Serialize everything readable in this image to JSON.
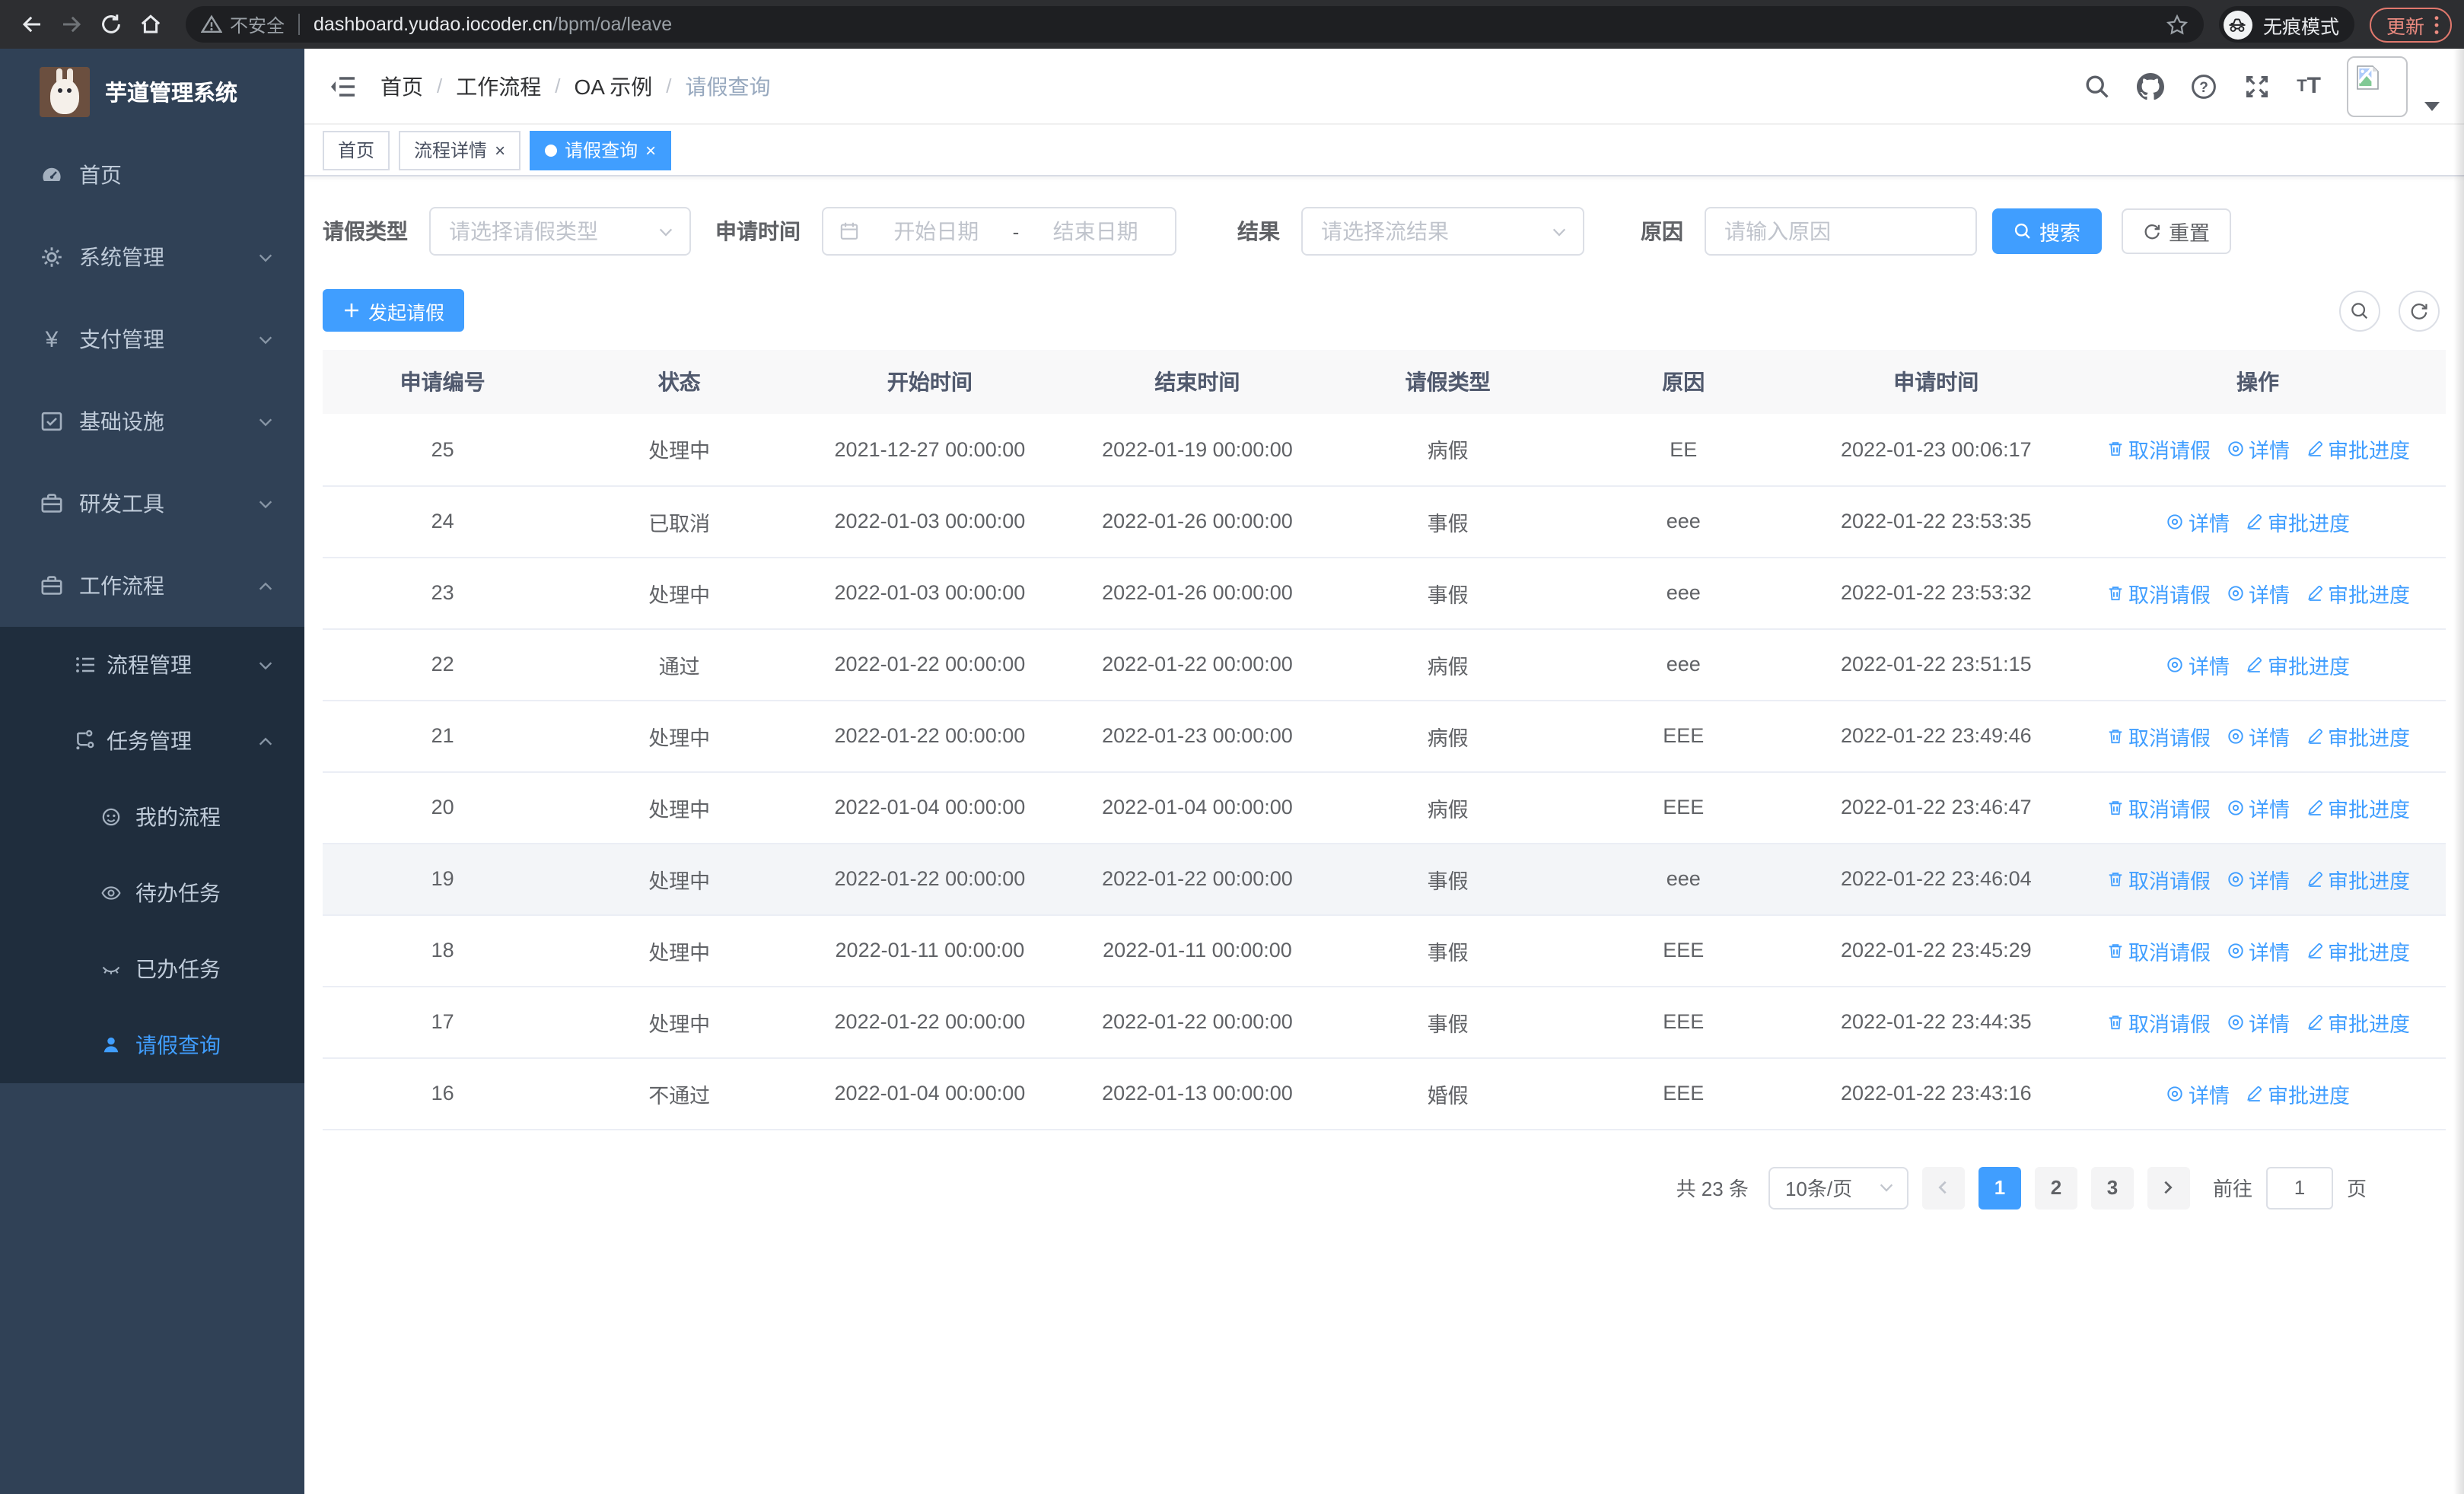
{
  "browser": {
    "security_label": "不安全",
    "url_host": "dashboard.yudao.iocoder.cn",
    "url_path": "/bpm/oa/leave",
    "incognito_label": "无痕模式",
    "update_label": "更新"
  },
  "sidebar": {
    "title": "芋道管理系统",
    "items": [
      {
        "label": "首页"
      },
      {
        "label": "系统管理"
      },
      {
        "label": "支付管理"
      },
      {
        "label": "基础设施"
      },
      {
        "label": "研发工具"
      },
      {
        "label": "工作流程",
        "sub": [
          {
            "label": "流程管理"
          },
          {
            "label": "任务管理",
            "sub": [
              {
                "label": "我的流程"
              },
              {
                "label": "待办任务"
              },
              {
                "label": "已办任务"
              },
              {
                "label": "请假查询",
                "active": true
              }
            ]
          }
        ]
      }
    ]
  },
  "header": {
    "breadcrumb": [
      "首页",
      "工作流程",
      "OA 示例",
      "请假查询"
    ]
  },
  "tabs": [
    {
      "label": "首页",
      "closable": false,
      "active": false
    },
    {
      "label": "流程详情",
      "closable": true,
      "active": false
    },
    {
      "label": "请假查询",
      "closable": true,
      "active": true
    }
  ],
  "filters": {
    "leave_type_label": "请假类型",
    "leave_type_placeholder": "请选择请假类型",
    "apply_time_label": "申请时间",
    "start_date_placeholder": "开始日期",
    "range_separator": "-",
    "end_date_placeholder": "结束日期",
    "result_label": "结果",
    "result_placeholder": "请选择流结果",
    "reason_label": "原因",
    "reason_placeholder": "请输入原因",
    "search_label": "搜索",
    "reset_label": "重置"
  },
  "toolbar": {
    "create_label": "发起请假"
  },
  "table": {
    "headers": [
      "申请编号",
      "状态",
      "开始时间",
      "结束时间",
      "请假类型",
      "原因",
      "申请时间",
      "操作"
    ],
    "action_labels": {
      "cancel": "取消请假",
      "detail": "详情",
      "progress": "审批进度"
    },
    "rows": [
      {
        "id": "25",
        "status": "处理中",
        "start": "2021-12-27 00:00:00",
        "end": "2022-01-19 00:00:00",
        "type": "病假",
        "reason": "EE",
        "apply_time": "2022-01-23 00:06:17",
        "actions": [
          "cancel",
          "detail",
          "progress"
        ],
        "highlight": false
      },
      {
        "id": "24",
        "status": "已取消",
        "start": "2022-01-03 00:00:00",
        "end": "2022-01-26 00:00:00",
        "type": "事假",
        "reason": "eee",
        "apply_time": "2022-01-22 23:53:35",
        "actions": [
          "detail",
          "progress"
        ],
        "highlight": false
      },
      {
        "id": "23",
        "status": "处理中",
        "start": "2022-01-03 00:00:00",
        "end": "2022-01-26 00:00:00",
        "type": "事假",
        "reason": "eee",
        "apply_time": "2022-01-22 23:53:32",
        "actions": [
          "cancel",
          "detail",
          "progress"
        ],
        "highlight": false
      },
      {
        "id": "22",
        "status": "通过",
        "start": "2022-01-22 00:00:00",
        "end": "2022-01-22 00:00:00",
        "type": "病假",
        "reason": "eee",
        "apply_time": "2022-01-22 23:51:15",
        "actions": [
          "detail",
          "progress"
        ],
        "highlight": false
      },
      {
        "id": "21",
        "status": "处理中",
        "start": "2022-01-22 00:00:00",
        "end": "2022-01-23 00:00:00",
        "type": "病假",
        "reason": "EEE",
        "apply_time": "2022-01-22 23:49:46",
        "actions": [
          "cancel",
          "detail",
          "progress"
        ],
        "highlight": false
      },
      {
        "id": "20",
        "status": "处理中",
        "start": "2022-01-04 00:00:00",
        "end": "2022-01-04 00:00:00",
        "type": "病假",
        "reason": "EEE",
        "apply_time": "2022-01-22 23:46:47",
        "actions": [
          "cancel",
          "detail",
          "progress"
        ],
        "highlight": false
      },
      {
        "id": "19",
        "status": "处理中",
        "start": "2022-01-22 00:00:00",
        "end": "2022-01-22 00:00:00",
        "type": "事假",
        "reason": "eee",
        "apply_time": "2022-01-22 23:46:04",
        "actions": [
          "cancel",
          "detail",
          "progress"
        ],
        "highlight": true
      },
      {
        "id": "18",
        "status": "处理中",
        "start": "2022-01-11 00:00:00",
        "end": "2022-01-11 00:00:00",
        "type": "事假",
        "reason": "EEE",
        "apply_time": "2022-01-22 23:45:29",
        "actions": [
          "cancel",
          "detail",
          "progress"
        ],
        "highlight": false
      },
      {
        "id": "17",
        "status": "处理中",
        "start": "2022-01-22 00:00:00",
        "end": "2022-01-22 00:00:00",
        "type": "事假",
        "reason": "EEE",
        "apply_time": "2022-01-22 23:44:35",
        "actions": [
          "cancel",
          "detail",
          "progress"
        ],
        "highlight": false
      },
      {
        "id": "16",
        "status": "不通过",
        "start": "2022-01-04 00:00:00",
        "end": "2022-01-13 00:00:00",
        "type": "婚假",
        "reason": "EEE",
        "apply_time": "2022-01-22 23:43:16",
        "actions": [
          "detail",
          "progress"
        ],
        "highlight": false
      }
    ]
  },
  "pagination": {
    "total_label": "共 23 条",
    "page_size_label": "10条/页",
    "pages": [
      "1",
      "2",
      "3"
    ],
    "active_page": "1",
    "goto_label": "前往",
    "goto_value": "1",
    "page_unit_label": "页"
  },
  "colors": {
    "primary": "#409eff",
    "sidebar_bg": "#304156",
    "submenu_bg": "#1f2d3d",
    "update_accent": "#ec8b80"
  }
}
